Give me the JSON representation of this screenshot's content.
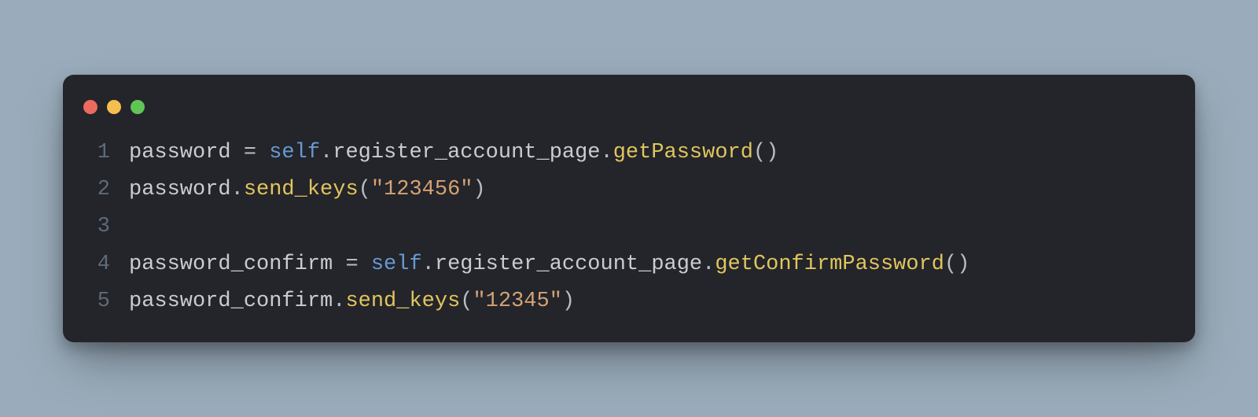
{
  "window": {
    "traffic_lights": {
      "close": "#ed6a5e",
      "minimize": "#f5bf4f",
      "zoom": "#61c554"
    }
  },
  "editor": {
    "line_numbers": [
      "1",
      "2",
      "3",
      "4",
      "5"
    ],
    "lines": [
      [
        {
          "t": "password",
          "c": "tk-v"
        },
        {
          "t": " ",
          "c": "tk-op"
        },
        {
          "t": "=",
          "c": "tk-op"
        },
        {
          "t": " ",
          "c": "tk-op"
        },
        {
          "t": "self",
          "c": "tk-self"
        },
        {
          "t": ".",
          "c": "tk-op"
        },
        {
          "t": "register_account_page",
          "c": "tk-prop"
        },
        {
          "t": ".",
          "c": "tk-op"
        },
        {
          "t": "getPassword",
          "c": "tk-fn"
        },
        {
          "t": "()",
          "c": "tk-par"
        }
      ],
      [
        {
          "t": "password",
          "c": "tk-v"
        },
        {
          "t": ".",
          "c": "tk-op"
        },
        {
          "t": "send_keys",
          "c": "tk-fn"
        },
        {
          "t": "(",
          "c": "tk-par"
        },
        {
          "t": "\"123456\"",
          "c": "tk-str"
        },
        {
          "t": ")",
          "c": "tk-par"
        }
      ],
      [],
      [
        {
          "t": "password_confirm",
          "c": "tk-v"
        },
        {
          "t": " ",
          "c": "tk-op"
        },
        {
          "t": "=",
          "c": "tk-op"
        },
        {
          "t": " ",
          "c": "tk-op"
        },
        {
          "t": "self",
          "c": "tk-self"
        },
        {
          "t": ".",
          "c": "tk-op"
        },
        {
          "t": "register_account_page",
          "c": "tk-prop"
        },
        {
          "t": ".",
          "c": "tk-op"
        },
        {
          "t": "getConfirmPassword",
          "c": "tk-fn"
        },
        {
          "t": "()",
          "c": "tk-par"
        }
      ],
      [
        {
          "t": "password_confirm",
          "c": "tk-v"
        },
        {
          "t": ".",
          "c": "tk-op"
        },
        {
          "t": "send_keys",
          "c": "tk-fn"
        },
        {
          "t": "(",
          "c": "tk-par"
        },
        {
          "t": "\"12345\"",
          "c": "tk-str"
        },
        {
          "t": ")",
          "c": "tk-par"
        }
      ]
    ]
  }
}
